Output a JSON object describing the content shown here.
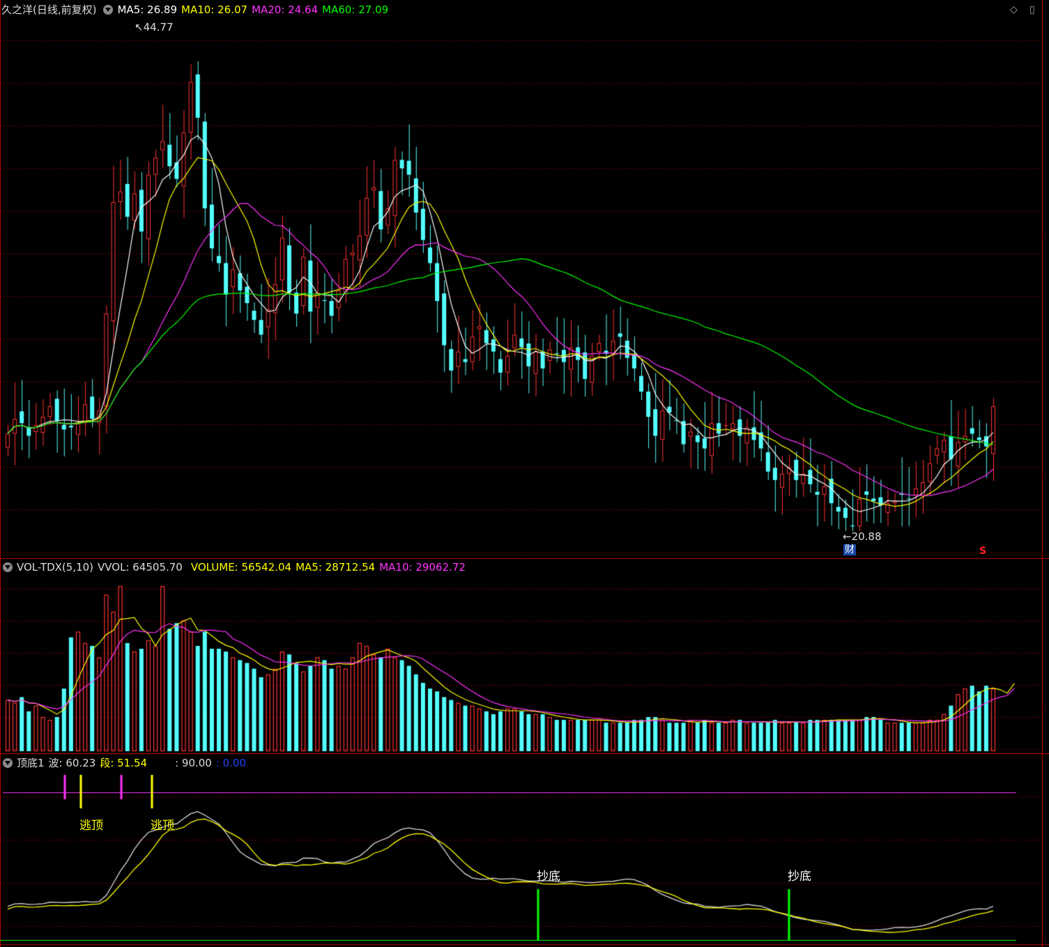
{
  "main_panel": {
    "title": "久之洋(日线,前复权)",
    "ma_labels": [
      {
        "text": "MA5: 26.89",
        "color": "#ffffff"
      },
      {
        "text": "MA10: 26.07",
        "color": "#ffff00"
      },
      {
        "text": "MA20: 24.64",
        "color": "#ff33ff"
      },
      {
        "text": "MA60: 27.09",
        "color": "#00ff00"
      }
    ],
    "high_label": "44.77",
    "low_label": "20.88",
    "marker_cai": "财",
    "marker_s": "S"
  },
  "volume_panel": {
    "name": "VOL-TDX(5,10)",
    "labels": [
      {
        "text": "VVOL: 64505.70",
        "color": "#dddddd"
      },
      {
        "text": "VOLUME: 56542.04",
        "color": "#ffff00"
      },
      {
        "text": "MA5: 28712.54",
        "color": "#ffff00"
      },
      {
        "text": "MA10: 29062.72",
        "color": "#ff33ff"
      }
    ]
  },
  "indicator_panel": {
    "name": "顶底1",
    "labels": [
      {
        "text": "波: 60.23",
        "color": "#dddddd"
      },
      {
        "text": "段: 51.54",
        "color": "#ffff00"
      },
      {
        "text": ": 90.00",
        "color": "#dddddd"
      },
      {
        "text": ": 0.00",
        "color": "#2244ff"
      }
    ],
    "signal_top": "逃顶",
    "signal_bottom": "抄底"
  },
  "colors": {
    "up": "#ff3333",
    "down": "#54ffff",
    "grid": "#7a0000",
    "border": "#c00000",
    "ma5": "#ffffff",
    "ma10": "#ffff00",
    "ma20": "#ff33ff",
    "ma60": "#00ff00"
  },
  "chart_data": {
    "type": "candlestick",
    "price_range": [
      20.88,
      44.77
    ],
    "closes": [
      25.5,
      26.2,
      26.0,
      25.4,
      25.9,
      26.3,
      26.8,
      26.1,
      25.7,
      25.8,
      26.0,
      26.9,
      26.2,
      26.6,
      31.2,
      36.5,
      37.0,
      35.8,
      36.9,
      35.1,
      37.8,
      38.6,
      39.4,
      38.2,
      37.6,
      39.8,
      42.2,
      40.5,
      36.2,
      34.3,
      33.6,
      32.1,
      33.3,
      32.3,
      31.7,
      30.9,
      30.2,
      31.4,
      32.6,
      34.8,
      32.2,
      31.2,
      33.9,
      31.3,
      32.2,
      31.8,
      31.1,
      32.3,
      33.8,
      34.1,
      34.9,
      36.7,
      37.2,
      35.2,
      36.2,
      38.5,
      38.1,
      37.8,
      36.0,
      34.7,
      33.6,
      31.8,
      29.7,
      28.5,
      29.4,
      28.9,
      30.1,
      30.6,
      29.8,
      29.4,
      28.4,
      29.2,
      30.2,
      29.6,
      28.7,
      29.4,
      28.6,
      29.5,
      29.3,
      28.9,
      29.6,
      29.0,
      28.1,
      29.2,
      29.8,
      29.3,
      29.9,
      30.1,
      29.1,
      28.6,
      27.5,
      26.3,
      25.4,
      26.6,
      26.5,
      26.1,
      25.0,
      25.6,
      25.1,
      24.8,
      26.0,
      25.5,
      25.9,
      26.0,
      25.4,
      25.8,
      25.2,
      24.8,
      23.7,
      23.3,
      23.6,
      23.9,
      23.3,
      23.6,
      23.1,
      22.6,
      23.0,
      22.2,
      21.8,
      21.5,
      21.1,
      22.4,
      22.6,
      22.3,
      22.1,
      22.2,
      22.3,
      22.6,
      22.4,
      22.9,
      23.2,
      24.1,
      24.8,
      25.2,
      24.3,
      25.1,
      25.4,
      25.5,
      25.2,
      24.9,
      26.8
    ],
    "volumes": [
      18,
      17,
      19,
      14,
      16,
      12,
      11,
      12,
      22,
      40,
      42,
      38,
      37,
      33,
      55,
      49,
      58,
      38,
      35,
      36,
      39,
      37,
      58,
      43,
      45,
      46,
      42,
      37,
      42,
      36,
      36,
      35,
      33,
      32,
      31,
      29,
      26,
      27,
      29,
      35,
      34,
      31,
      28,
      30,
      33,
      32,
      29,
      30,
      29,
      33,
      38,
      37,
      34,
      33,
      36,
      33,
      32,
      30,
      27,
      24,
      22,
      21,
      19,
      18,
      17,
      16,
      16,
      15,
      14,
      13,
      14,
      15,
      15,
      14,
      13,
      13,
      13,
      12,
      11,
      11,
      11,
      11,
      11,
      11,
      11,
      10,
      10,
      10,
      10,
      11,
      11,
      12,
      12,
      11,
      10,
      10,
      10,
      11,
      10,
      11,
      10,
      10,
      10,
      11,
      11,
      10,
      10,
      10,
      10,
      11,
      10,
      10,
      10,
      10,
      11,
      11,
      11,
      11,
      11,
      11,
      11,
      11,
      12,
      12,
      11,
      10,
      10,
      10,
      10,
      10,
      10,
      11,
      11,
      13,
      16,
      20,
      22,
      23,
      21,
      23,
      22,
      19,
      17,
      38
    ]
  }
}
